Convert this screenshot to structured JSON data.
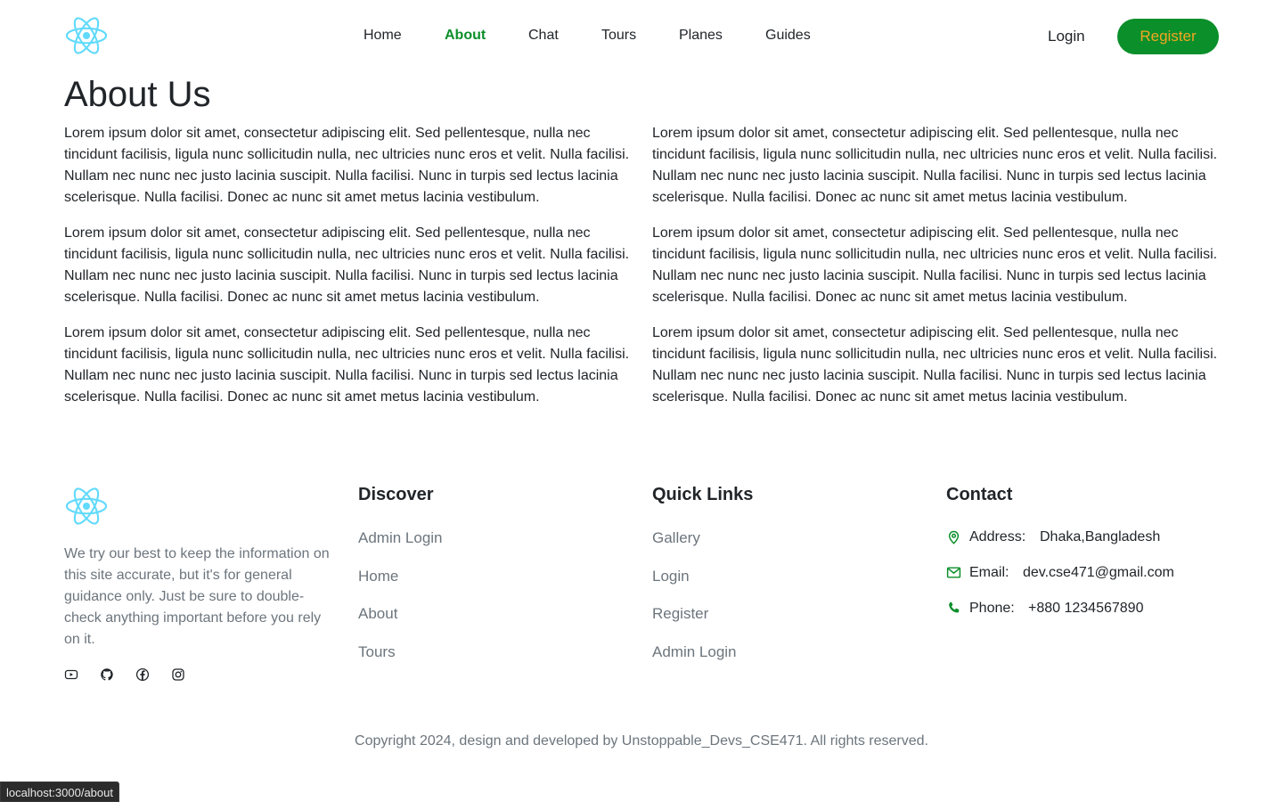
{
  "colors": {
    "brand_green": "#0b8f2a",
    "register_text": "#f5a623",
    "logo_cyan": "#61dafb"
  },
  "header": {
    "logo_icon": "react-logo-icon",
    "nav": [
      "Home",
      "About",
      "Chat",
      "Tours",
      "Planes",
      "Guides"
    ],
    "active_nav": "About",
    "login_label": "Login",
    "register_label": "Register"
  },
  "main": {
    "title": "About Us",
    "paragraph": "Lorem ipsum dolor sit amet, consectetur adipiscing elit. Sed pellentesque, nulla nec tincidunt facilisis, ligula nunc sollicitudin nulla, nec ultricies nunc eros et velit. Nulla facilisi. Nullam nec nunc nec justo lacinia suscipit. Nulla facilisi. Nunc in turpis sed lectus lacinia scelerisque. Nulla facilisi. Donec ac nunc sit amet metus lacinia vestibulum."
  },
  "footer": {
    "description": "We try our best to keep the information on this site accurate, but it's for general guidance only. Just be sure to double-check anything important before you rely on it.",
    "social_icons": [
      "youtube-icon",
      "github-icon",
      "facebook-icon",
      "instagram-icon"
    ],
    "discover": {
      "title": "Discover",
      "links": [
        "Admin Login",
        "Home",
        "About",
        "Tours"
      ]
    },
    "quick_links": {
      "title": "Quick Links",
      "links": [
        "Gallery",
        "Login",
        "Register",
        "Admin Login"
      ]
    },
    "contact": {
      "title": "Contact",
      "address_label": "Address:",
      "address_value": "Dhaka,Bangladesh",
      "email_label": "Email:",
      "email_value": "dev.cse471@gmail.com",
      "phone_label": "Phone:",
      "phone_value": "+880 1234567890"
    },
    "copyright": "Copyright 2024, design and developed by Unstoppable_Devs_CSE471. All rights reserved."
  },
  "status_url": "localhost:3000/about"
}
